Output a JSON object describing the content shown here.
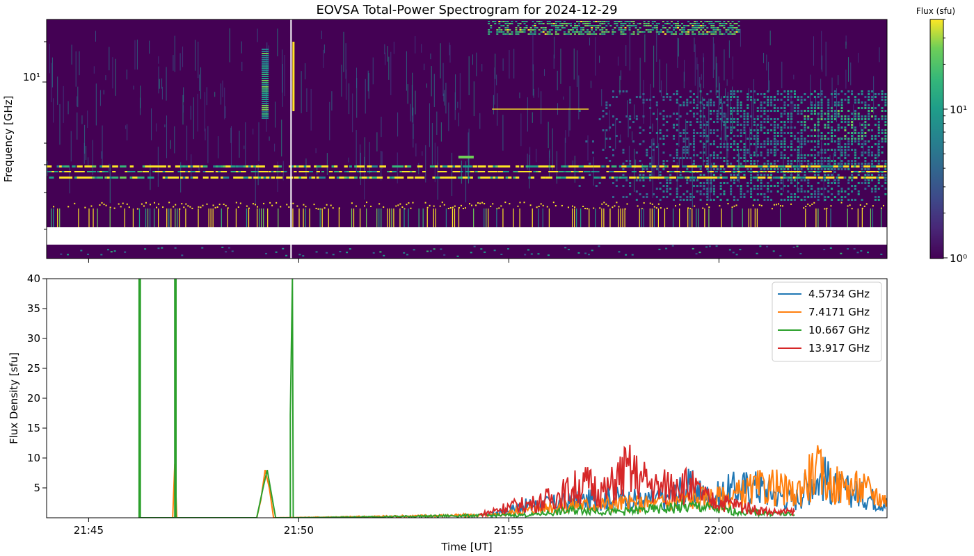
{
  "title": "EOVSA Total-Power Spectrogram for 2024-12-29",
  "colors": {
    "viridis_low": "#440154",
    "viridis_mid": "#21918c",
    "viridis_high": "#fde725",
    "c0": "#1f77b4",
    "c1": "#ff7f0e",
    "c2": "#2ca02c",
    "c3": "#d62728"
  },
  "chart_data": [
    {
      "type": "heatmap",
      "title": "EOVSA Total-Power Spectrogram for 2024-12-29",
      "ylabel": "Frequency [GHz]",
      "xlabel": "",
      "y_scale": "log",
      "y_tick_label": "10¹",
      "x_ticks_minutes": [
        5,
        10,
        15,
        20
      ],
      "colorbar": {
        "label": "Flux (sfu)",
        "scale": "log",
        "range": [
          1,
          40
        ],
        "tick_labels": [
          {
            "value": 1,
            "label": "10⁰"
          },
          {
            "value": 10,
            "label": "10¹"
          }
        ],
        "colormap": "viridis"
      },
      "notes": "High flux bands near 2.0–2.3 GHz and 3.1–3.6 GHz; broadband enhancement after 21:58 UT"
    },
    {
      "type": "line",
      "xlabel": "Time [UT]",
      "ylabel": "Flux Density [sfu]",
      "x_unit": "UT (minutes after 21:40)",
      "x_range": [
        4,
        24
      ],
      "ylim": [
        0,
        40
      ],
      "y_ticks": [
        5,
        10,
        15,
        20,
        25,
        30,
        35,
        40
      ],
      "x_ticks": [
        {
          "value": 5,
          "label": "21:45"
        },
        {
          "value": 10,
          "label": "21:50"
        },
        {
          "value": 15,
          "label": "21:55"
        },
        {
          "value": 20,
          "label": "22:00"
        }
      ],
      "legend_position": "top-right",
      "series": [
        {
          "name": "4.5734 GHz",
          "color": "#1f77b4",
          "points": [
            [
              14.5,
              0.5
            ],
            [
              15.3,
              2.0
            ],
            [
              16.0,
              2.5
            ],
            [
              16.8,
              3.0
            ],
            [
              17.5,
              3.5
            ],
            [
              18.2,
              3.0
            ],
            [
              18.8,
              3.5
            ],
            [
              19.3,
              5.5
            ],
            [
              19.8,
              3.5
            ],
            [
              20.3,
              5.0
            ],
            [
              20.8,
              5.5
            ],
            [
              21.3,
              4.5
            ],
            [
              21.8,
              3.0
            ],
            [
              22.2,
              6.5
            ],
            [
              22.5,
              7.0
            ],
            [
              22.8,
              5.0
            ],
            [
              23.2,
              4.5
            ],
            [
              23.6,
              3.5
            ],
            [
              24.0,
              2.5
            ]
          ]
        },
        {
          "name": "7.4171 GHz",
          "color": "#ff7f0e",
          "points": [
            [
              7.0,
              0
            ],
            [
              7.05,
              9.0
            ],
            [
              7.1,
              0
            ],
            [
              9.0,
              0
            ],
            [
              9.1,
              3.0
            ],
            [
              9.2,
              8.0
            ],
            [
              9.3,
              5.0
            ],
            [
              9.4,
              0
            ],
            [
              14.7,
              0.5
            ],
            [
              16.0,
              2.0
            ],
            [
              17.5,
              2.5
            ],
            [
              18.5,
              2.5
            ],
            [
              19.5,
              3.5
            ],
            [
              20.2,
              3.5
            ],
            [
              20.8,
              5.0
            ],
            [
              21.3,
              5.5
            ],
            [
              21.8,
              4.0
            ],
            [
              22.3,
              8.5
            ],
            [
              22.6,
              6.0
            ],
            [
              23.0,
              5.5
            ],
            [
              23.5,
              5.0
            ],
            [
              24.0,
              3.0
            ]
          ]
        },
        {
          "name": "10.667 GHz",
          "color": "#2ca02c",
          "points": [
            [
              6.2,
              0
            ],
            [
              6.2,
              40
            ],
            [
              6.23,
              40
            ],
            [
              6.23,
              0
            ],
            [
              7.05,
              0
            ],
            [
              7.05,
              40
            ],
            [
              7.08,
              40
            ],
            [
              7.08,
              0
            ],
            [
              9.0,
              0
            ],
            [
              9.15,
              5.0
            ],
            [
              9.25,
              8.0
            ],
            [
              9.35,
              4.0
            ],
            [
              9.45,
              0
            ],
            [
              9.8,
              0
            ],
            [
              9.8,
              17.2
            ],
            [
              9.85,
              40
            ],
            [
              9.87,
              0
            ],
            [
              15.5,
              0.5
            ],
            [
              16.8,
              1.5
            ],
            [
              17.5,
              1.0
            ],
            [
              18.5,
              1.5
            ],
            [
              19.5,
              2.0
            ],
            [
              20.5,
              1.0
            ],
            [
              21.3,
              0.8
            ],
            [
              21.8,
              0.5
            ]
          ]
        },
        {
          "name": "13.917 GHz",
          "color": "#d62728",
          "points": [
            [
              14.3,
              0.5
            ],
            [
              15.0,
              2.0
            ],
            [
              15.6,
              2.5
            ],
            [
              16.2,
              4.0
            ],
            [
              16.8,
              6.0
            ],
            [
              17.3,
              4.5
            ],
            [
              17.8,
              8.5
            ],
            [
              18.2,
              6.5
            ],
            [
              18.6,
              5.0
            ],
            [
              19.0,
              6.5
            ],
            [
              19.4,
              5.0
            ],
            [
              19.8,
              3.0
            ],
            [
              20.3,
              2.5
            ],
            [
              20.8,
              1.5
            ],
            [
              21.3,
              1.0
            ],
            [
              21.8,
              1.0
            ]
          ]
        }
      ]
    }
  ]
}
